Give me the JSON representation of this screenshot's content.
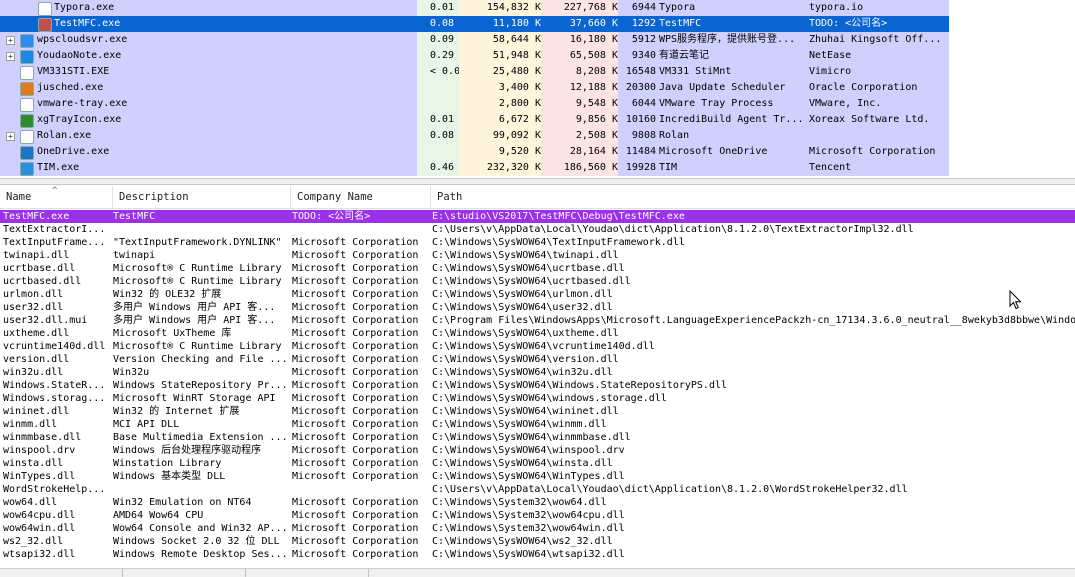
{
  "processes": [
    {
      "name": "Typora.exe",
      "cpu": "0.01",
      "private": "154,832 K",
      "working": "227,768 K",
      "pid": "6944",
      "desc": "Typora",
      "company": "typora.io",
      "indent": 1,
      "icon": "typora-icon",
      "iconColor": "#ffffff",
      "expander": ""
    },
    {
      "name": "TestMFC.exe",
      "cpu": "0.08",
      "private": "11,180 K",
      "working": "37,660 K",
      "pid": "1292",
      "desc": "TestMFC",
      "company": "TODO: <公司名>",
      "indent": 1,
      "icon": "mfc-app-icon",
      "iconColor": "#c0504d",
      "expander": "",
      "selected": true
    },
    {
      "name": "wpscloudsvr.exe",
      "cpu": "0.09",
      "private": "58,644 K",
      "working": "16,180 K",
      "pid": "5912",
      "desc": "WPS服务程序，提供账号登...",
      "company": "Zhuhai Kingsoft Off...",
      "indent": 0,
      "icon": "wps-cloud-icon",
      "iconColor": "#2d8cf0",
      "expander": "+"
    },
    {
      "name": "YoudaoNote.exe",
      "cpu": "0.29",
      "private": "51,948 K",
      "working": "65,508 K",
      "pid": "9340",
      "desc": "有道云笔记",
      "company": "NetEase",
      "indent": 0,
      "icon": "youdao-note-icon",
      "iconColor": "#1e88e5",
      "expander": "+"
    },
    {
      "name": "VM331STI.EXE",
      "cpu": "< 0.01",
      "private": "25,480 K",
      "working": "8,208 K",
      "pid": "16548",
      "desc": "VM331 StiMnt",
      "company": "Vimicro",
      "indent": 0,
      "icon": "generic-exe-icon",
      "iconColor": "#ffffff",
      "expander": ""
    },
    {
      "name": "jusched.exe",
      "cpu": "",
      "private": "3,400 K",
      "working": "12,188 K",
      "pid": "20300",
      "desc": "Java Update Scheduler",
      "company": "Oracle Corporation",
      "indent": 0,
      "icon": "java-icon",
      "iconColor": "#e07b20",
      "expander": ""
    },
    {
      "name": "vmware-tray.exe",
      "cpu": "",
      "private": "2,800 K",
      "working": "9,548 K",
      "pid": "6044",
      "desc": "VMware Tray Process",
      "company": "VMware, Inc.",
      "indent": 0,
      "icon": "vmware-icon",
      "iconColor": "#ffffff",
      "expander": ""
    },
    {
      "name": "xgTrayIcon.exe",
      "cpu": "0.01",
      "private": "6,672 K",
      "working": "9,856 K",
      "pid": "10160",
      "desc": "IncrediBuild Agent Tr...",
      "company": "Xoreax Software Ltd.",
      "indent": 0,
      "icon": "incredibuild-icon",
      "iconColor": "#2e8b2e",
      "expander": ""
    },
    {
      "name": "Rolan.exe",
      "cpu": "0.08",
      "private": "99,092 K",
      "working": "2,508 K",
      "pid": "9808",
      "desc": "Rolan",
      "company": "",
      "indent": 0,
      "icon": "rolan-icon",
      "iconColor": "#ffffff",
      "expander": "+"
    },
    {
      "name": "OneDrive.exe",
      "cpu": "",
      "private": "9,520 K",
      "working": "28,164 K",
      "pid": "11484",
      "desc": "Microsoft OneDrive",
      "company": "Microsoft Corporation",
      "indent": 0,
      "icon": "onedrive-icon",
      "iconColor": "#1e73c8",
      "expander": ""
    },
    {
      "name": "TIM.exe",
      "cpu": "0.46",
      "private": "232,320 K",
      "working": "186,560 K",
      "pid": "19928",
      "desc": "TIM",
      "company": "Tencent",
      "indent": 0,
      "icon": "tim-icon",
      "iconColor": "#2b8fe0",
      "expander": ""
    }
  ],
  "dll_headers": {
    "name": "Name",
    "description": "Description",
    "company": "Company Name",
    "path": "Path"
  },
  "dlls": [
    {
      "name": "TestMFC.exe",
      "desc": "TestMFC",
      "company": "TODO: <公司名>",
      "path": "E:\\studio\\VS2017\\TestMFC\\Debug\\TestMFC.exe",
      "selected": true
    },
    {
      "name": "TextExtractorI...",
      "desc": "",
      "company": "",
      "path": "C:\\Users\\v\\AppData\\Local\\Youdao\\dict\\Application\\8.1.2.0\\TextExtractorImpl32.dll"
    },
    {
      "name": "TextInputFrame...",
      "desc": "\"TextInputFramework.DYNLINK\"",
      "company": "Microsoft Corporation",
      "path": "C:\\Windows\\SysWOW64\\TextInputFramework.dll"
    },
    {
      "name": "twinapi.dll",
      "desc": "twinapi",
      "company": "Microsoft Corporation",
      "path": "C:\\Windows\\SysWOW64\\twinapi.dll"
    },
    {
      "name": "ucrtbase.dll",
      "desc": "Microsoft® C Runtime Library",
      "company": "Microsoft Corporation",
      "path": "C:\\Windows\\SysWOW64\\ucrtbase.dll"
    },
    {
      "name": "ucrtbased.dll",
      "desc": "Microsoft® C Runtime Library",
      "company": "Microsoft Corporation",
      "path": "C:\\Windows\\SysWOW64\\ucrtbased.dll"
    },
    {
      "name": "urlmon.dll",
      "desc": "Win32 的 OLE32 扩展",
      "company": "Microsoft Corporation",
      "path": "C:\\Windows\\SysWOW64\\urlmon.dll"
    },
    {
      "name": "user32.dll",
      "desc": "多用户 Windows 用户 API 客...",
      "company": "Microsoft Corporation",
      "path": "C:\\Windows\\SysWOW64\\user32.dll"
    },
    {
      "name": "user32.dll.mui",
      "desc": "多用户 Windows 用户 API 客...",
      "company": "Microsoft Corporation",
      "path": "C:\\Program Files\\WindowsApps\\Microsoft.LanguageExperiencePackzh-cn_17134.3.6.0_neutral__8wekyb3d8bbwe\\Windo"
    },
    {
      "name": "uxtheme.dll",
      "desc": "Microsoft UxTheme 库",
      "company": "Microsoft Corporation",
      "path": "C:\\Windows\\SysWOW64\\uxtheme.dll"
    },
    {
      "name": "vcruntime140d.dll",
      "desc": "Microsoft® C Runtime Library",
      "company": "Microsoft Corporation",
      "path": "C:\\Windows\\SysWOW64\\vcruntime140d.dll"
    },
    {
      "name": "version.dll",
      "desc": "Version Checking and File ...",
      "company": "Microsoft Corporation",
      "path": "C:\\Windows\\SysWOW64\\version.dll"
    },
    {
      "name": "win32u.dll",
      "desc": "Win32u",
      "company": "Microsoft Corporation",
      "path": "C:\\Windows\\SysWOW64\\win32u.dll"
    },
    {
      "name": "Windows.StateR...",
      "desc": "Windows StateRepository Pr...",
      "company": "Microsoft Corporation",
      "path": "C:\\Windows\\SysWOW64\\Windows.StateRepositoryPS.dll"
    },
    {
      "name": "Windows.storag...",
      "desc": "Microsoft WinRT Storage API",
      "company": "Microsoft Corporation",
      "path": "C:\\Windows\\SysWOW64\\windows.storage.dll"
    },
    {
      "name": "wininet.dll",
      "desc": "Win32 的 Internet 扩展",
      "company": "Microsoft Corporation",
      "path": "C:\\Windows\\SysWOW64\\wininet.dll"
    },
    {
      "name": "winmm.dll",
      "desc": "MCI API DLL",
      "company": "Microsoft Corporation",
      "path": "C:\\Windows\\SysWOW64\\winmm.dll"
    },
    {
      "name": "winmmbase.dll",
      "desc": "Base Multimedia Extension ...",
      "company": "Microsoft Corporation",
      "path": "C:\\Windows\\SysWOW64\\winmmbase.dll"
    },
    {
      "name": "winspool.drv",
      "desc": "Windows 后台处理程序驱动程序",
      "company": "Microsoft Corporation",
      "path": "C:\\Windows\\SysWOW64\\winspool.drv"
    },
    {
      "name": "winsta.dll",
      "desc": "Winstation Library",
      "company": "Microsoft Corporation",
      "path": "C:\\Windows\\SysWOW64\\winsta.dll"
    },
    {
      "name": "WinTypes.dll",
      "desc": "Windows 基本类型 DLL",
      "company": "Microsoft Corporation",
      "path": "C:\\Windows\\SysWOW64\\WinTypes.dll"
    },
    {
      "name": "WordStrokeHelp...",
      "desc": "",
      "company": "",
      "path": "C:\\Users\\v\\AppData\\Local\\Youdao\\dict\\Application\\8.1.2.0\\WordStrokeHelper32.dll"
    },
    {
      "name": "wow64.dll",
      "desc": "Win32 Emulation on NT64",
      "company": "Microsoft Corporation",
      "path": "C:\\Windows\\System32\\wow64.dll"
    },
    {
      "name": "wow64cpu.dll",
      "desc": "AMD64 Wow64 CPU",
      "company": "Microsoft Corporation",
      "path": "C:\\Windows\\System32\\wow64cpu.dll"
    },
    {
      "name": "wow64win.dll",
      "desc": "Wow64 Console and Win32 AP...",
      "company": "Microsoft Corporation",
      "path": "C:\\Windows\\System32\\wow64win.dll"
    },
    {
      "name": "ws2_32.dll",
      "desc": "Windows Socket 2.0 32 位 DLL",
      "company": "Microsoft Corporation",
      "path": "C:\\Windows\\SysWOW64\\ws2_32.dll"
    },
    {
      "name": "wtsapi32.dll",
      "desc": "Windows Remote Desktop Ses...",
      "company": "Microsoft Corporation",
      "path": "C:\\Windows\\SysWOW64\\wtsapi32.dll"
    }
  ],
  "colors": {
    "proc_name_bg": "#d0d0ff",
    "cpu_bg": "#e8f6e8",
    "private_bg": "#fff4dc",
    "working_bg": "#fde4e4",
    "selected_process": "#0a64d2",
    "selected_dll": "#9932e8"
  }
}
